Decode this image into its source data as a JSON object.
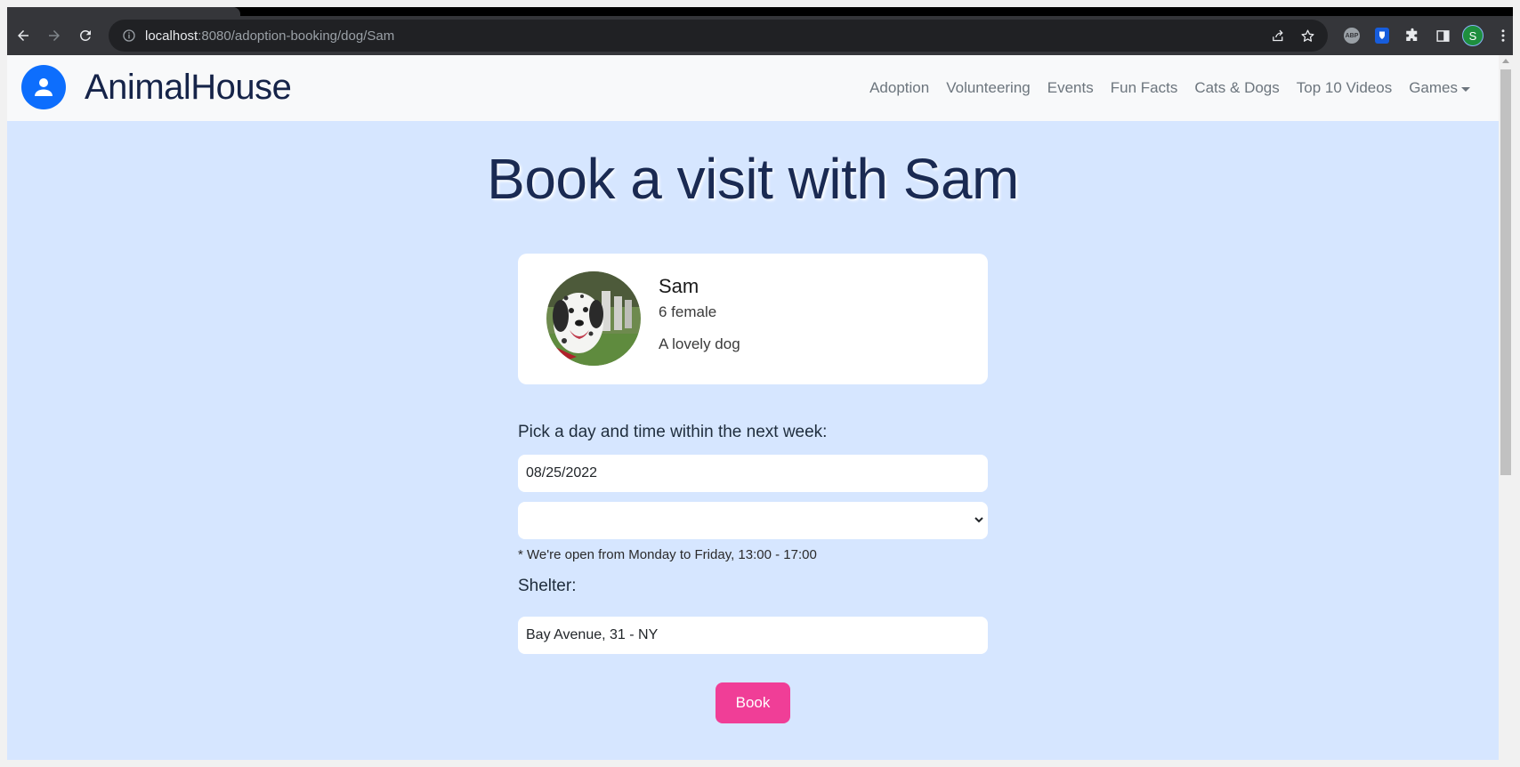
{
  "browser": {
    "url_host": "localhost",
    "url_path": ":8080/adoption-booking/dog/Sam",
    "profile_initial": "S",
    "abp_label": "ABP"
  },
  "site": {
    "brand": "AnimalHouse",
    "nav": [
      {
        "label": "Adoption"
      },
      {
        "label": "Volunteering"
      },
      {
        "label": "Events"
      },
      {
        "label": "Fun Facts"
      },
      {
        "label": "Cats & Dogs"
      },
      {
        "label": "Top 10 Videos"
      },
      {
        "label": "Games"
      }
    ]
  },
  "page": {
    "title": "Book a visit with Sam",
    "pet": {
      "name": "Sam",
      "meta": "6 female",
      "description": "A lovely dog"
    },
    "form": {
      "pick_label": "Pick a day and time within the next week:",
      "date_value": "08/25/2022",
      "time_value": "",
      "hours_note": "* We're open from Monday to Friday, 13:00 - 17:00",
      "shelter_label": "Shelter:",
      "shelter_value": "Bay Avenue, 31 - NY",
      "book_label": "Book"
    }
  },
  "colors": {
    "page_bg": "#d6e6ff",
    "brand_blue": "#0d6efd",
    "title_navy": "#1a2a52",
    "book_pink": "#f03e97"
  },
  "icons": {
    "brand": "person-icon",
    "games": "caret-down-icon",
    "select": "chevron-down-icon"
  }
}
